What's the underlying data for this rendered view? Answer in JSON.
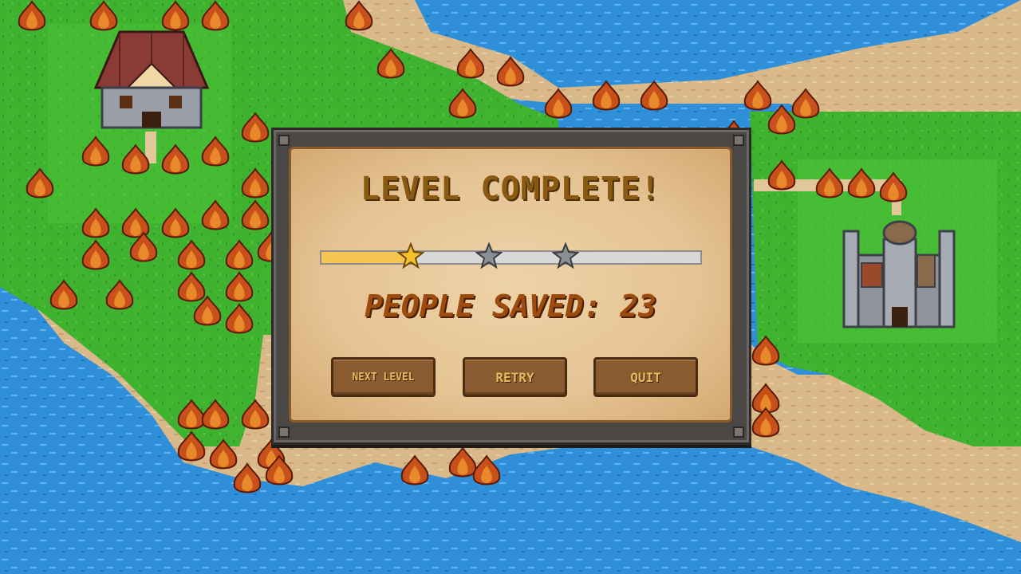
{
  "dialog": {
    "title": "LEVEL COMPLETE!",
    "people_saved_text": "PEOPLE SAVED: 23",
    "progress_fraction": 0.24,
    "stars_total": 3,
    "stars_earned": 1
  },
  "buttons": {
    "next_level": "NEXT LEVEL",
    "retry": "RETRY",
    "quit": "QUIT"
  },
  "colors": {
    "water": "#2f8fd8",
    "grass": "#3fb22f",
    "sand": "#d9b98a",
    "fire": "#c8501a",
    "parchment": "#e8c99a",
    "title_text": "#8a5a12",
    "saved_text": "#9d4b0e",
    "progress_fill": "#f5c451",
    "star_earned": "#f7c02a",
    "star_empty": "#8b8f94"
  },
  "icons": {
    "star_earned": "star-gold-icon",
    "star_empty": "star-gray-icon",
    "fire": "fire-icon",
    "castle": "castle-icon",
    "house": "house-icon"
  }
}
